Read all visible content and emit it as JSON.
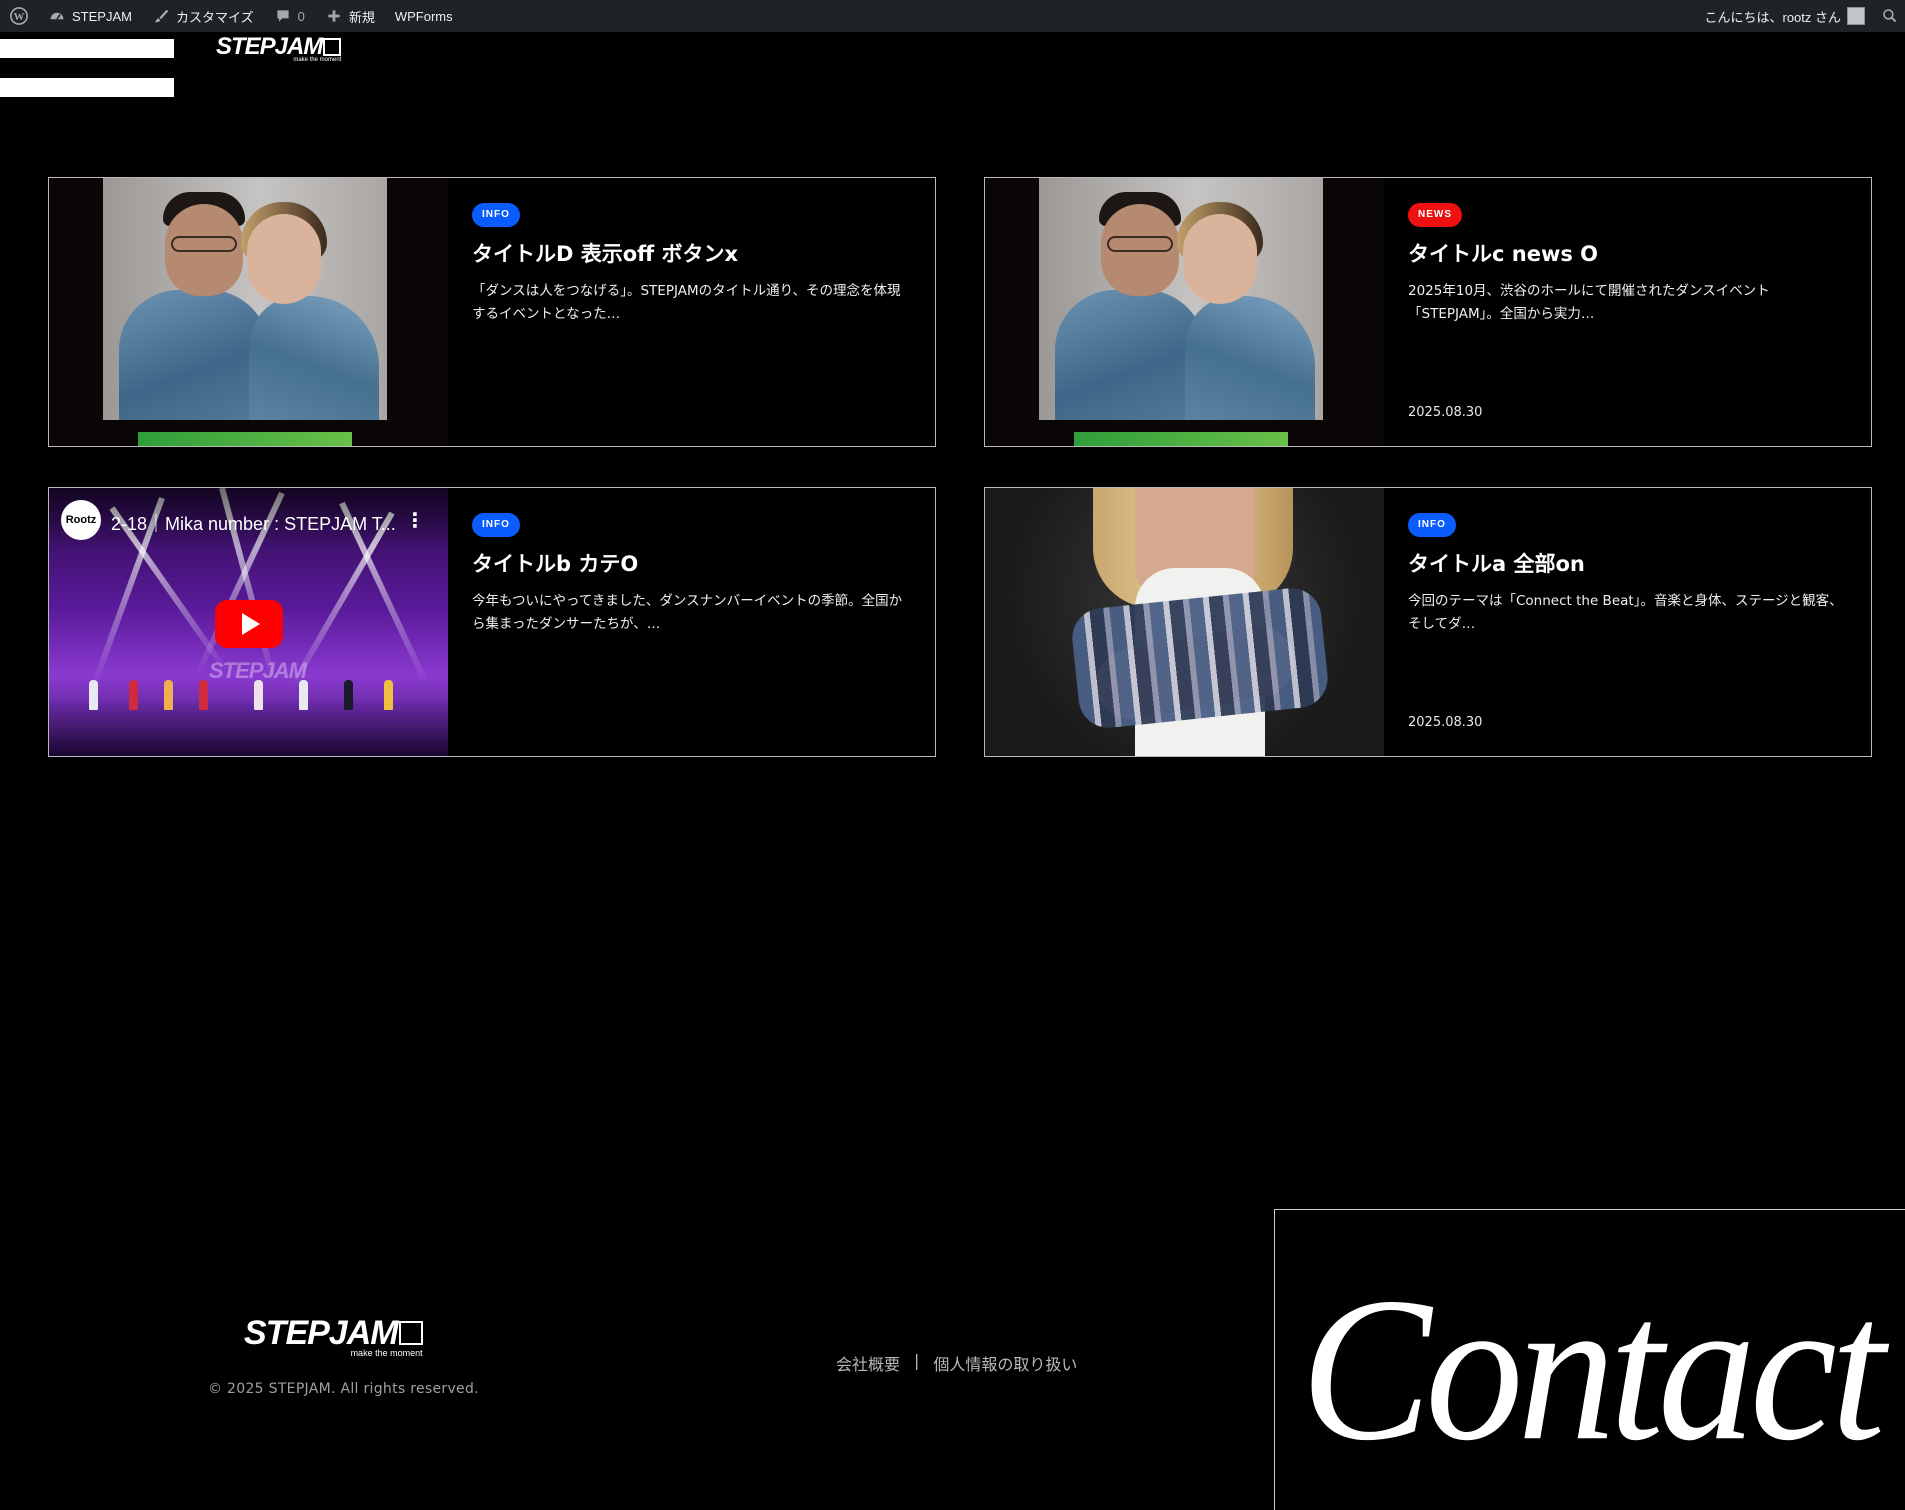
{
  "adminbar": {
    "site_name": "STEPJAM",
    "customize": "カスタマイズ",
    "comments_count": "0",
    "new": "新規",
    "wpforms": "WPForms",
    "greeting": "こんにちは、rootz さん"
  },
  "header": {
    "logo": "STEPJAM",
    "logo_tagline": "make the moment"
  },
  "cards": [
    {
      "badge": "INFO",
      "title": "タイトルD 表示off ボタンx",
      "excerpt": "「ダンスは人をつなげる」。STEPJAMのタイトル通り、その理念を体現するイベントとなった…",
      "date": ""
    },
    {
      "badge": "NEWS",
      "title": "タイトルc news O",
      "excerpt": "2025年10月、渋谷のホールにて開催されたダンスイベント「STEPJAM」。全国から実力…",
      "date": "2025.08.30"
    },
    {
      "badge": "INFO",
      "title": "タイトルb カテO",
      "excerpt": "今年もついにやってきました、ダンスナンバーイベントの季節。全国から集まったダンサーたちが、…",
      "date": "",
      "video": {
        "channel": "Rootz",
        "title": "2-18｜Mika number : STEPJAM T..."
      }
    },
    {
      "badge": "INFO",
      "title": "タイトルa 全部on",
      "excerpt": "今回のテーマは「Connect the Beat」。音楽と身体、ステージと観客、そしてダ…",
      "date": "2025.08.30"
    }
  ],
  "footer": {
    "logo": "STEPJAM",
    "logo_tagline": "make the moment",
    "copyright": "© 2025 STEPJAM. All rights reserved.",
    "link_company": "会社概要",
    "separator": "|",
    "link_privacy": "個人情報の取り扱い",
    "contact": "Contact"
  },
  "colors": {
    "background": "#000000",
    "adminbar": "#1d2327",
    "badge_info": "#0a5cff",
    "badge_news": "#ee1111"
  },
  "icons": [
    "wordpress-icon",
    "dashboard-icon",
    "brush-icon",
    "comment-icon",
    "plus-icon",
    "avatar-icon",
    "search-icon",
    "hamburger-icon",
    "play-icon",
    "more-vertical-icon"
  ]
}
